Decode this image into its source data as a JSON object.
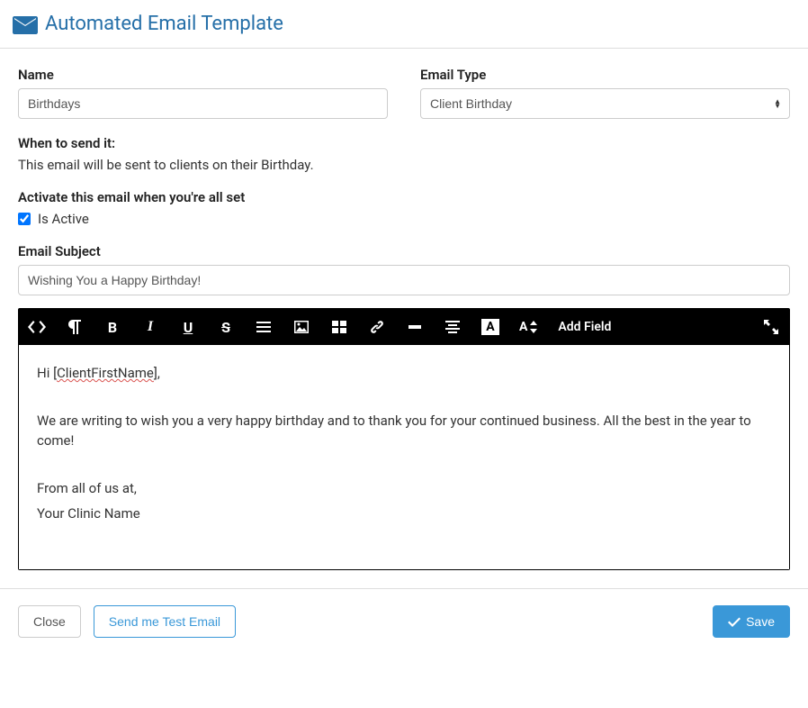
{
  "header": {
    "title": "Automated Email Template"
  },
  "fields": {
    "name_label": "Name",
    "name_value": "Birthdays",
    "email_type_label": "Email Type",
    "email_type_value": "Client Birthday",
    "when_label": "When to send it:",
    "when_text": "This email will be sent to clients on their Birthday.",
    "activate_label": "Activate this email when you're all set",
    "is_active_label": "Is Active",
    "is_active_checked": true,
    "subject_label": "Email Subject",
    "subject_value": "Wishing You a Happy Birthday!"
  },
  "toolbar": {
    "add_field_label": "Add Field",
    "font_color_box_letter": "A",
    "font_size_letter": "A"
  },
  "body": {
    "greeting_prefix": "Hi [",
    "merge_field": "ClientFirstName",
    "greeting_suffix": "],",
    "paragraph": "We are writing to wish you a very happy birthday and to thank you for your continued business. All the best in the year to come!",
    "signoff1": "From all of us at,",
    "signoff2": "Your Clinic Name"
  },
  "footer": {
    "close_label": "Close",
    "test_label": "Send me Test Email",
    "save_label": "Save"
  }
}
